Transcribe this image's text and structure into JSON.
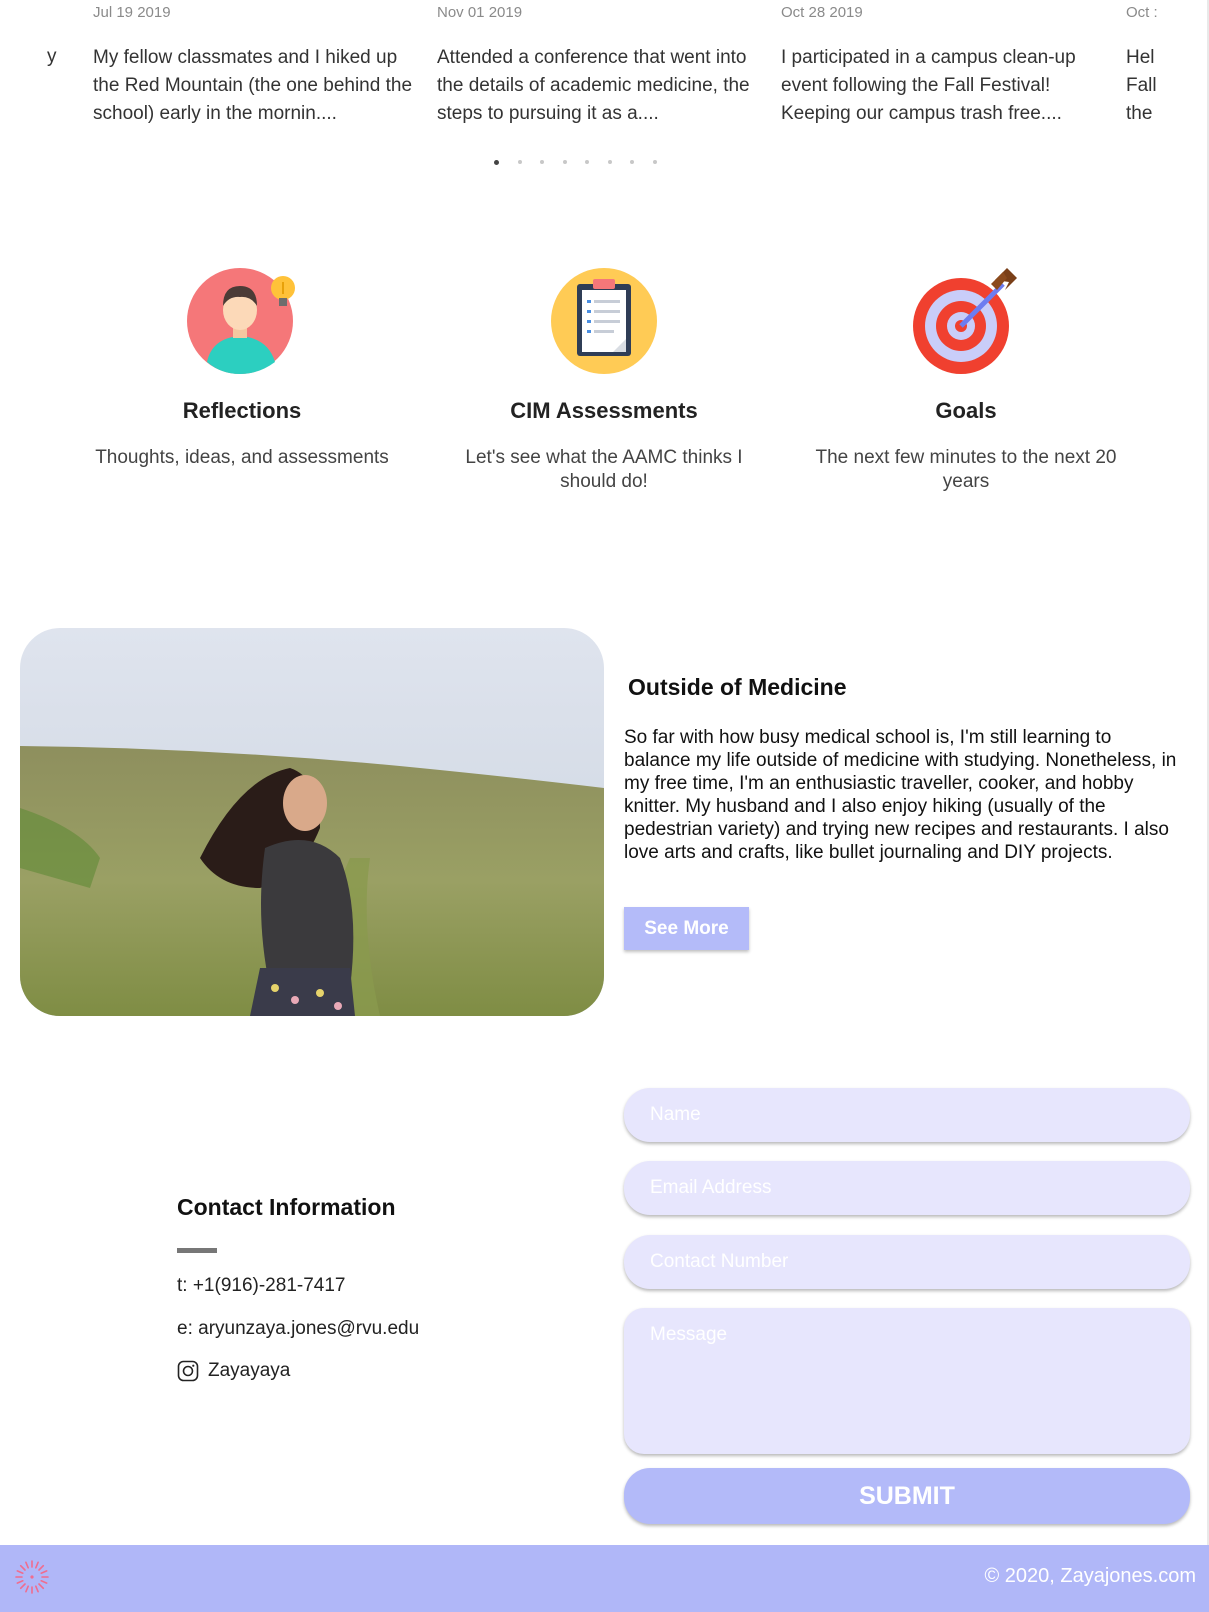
{
  "posts": [
    {
      "date": "Jul 19 2019",
      "excerpt": "My fellow classmates and I hiked up the Red Mountain (the one behind the school) early in the mornin...."
    },
    {
      "date": "Nov 01 2019",
      "excerpt": "Attended a conference that went into the details of academic medicine, the steps to pursuing it as a...."
    },
    {
      "date": "Oct 28 2019",
      "excerpt": "I participated in a campus clean-up event following the Fall Festival! Keeping our campus trash free...."
    },
    {
      "date": "Oct :",
      "excerpt": "Hel Fall the"
    }
  ],
  "prev_post_fragment": "y",
  "carousel": {
    "dot_count": 8,
    "active_index": 0
  },
  "features": [
    {
      "title": "Reflections",
      "description": "Thoughts, ideas, and assessments",
      "icon": "person-lightbulb-icon"
    },
    {
      "title": "CIM Assessments",
      "description": "Let's see what the AAMC thinks I should do!",
      "icon": "clipboard-icon"
    },
    {
      "title": "Goals",
      "description": "The next few minutes to the next 20 years",
      "icon": "target-arrow-icon"
    }
  ],
  "outside_medicine": {
    "title": "Outside of Medicine",
    "body": "So far with how busy medical school is, I'm still learning to balance my life outside of medicine with studying. Nonetheless, in my free time, I'm an enthusiastic traveller, cooker, and hobby knitter. My husband and I also enjoy hiking (usually of the pedestrian variety) and trying new recipes and restaurants. I also love arts and crafts, like bullet journaling and DIY projects.",
    "button_label": "See More"
  },
  "contact": {
    "title": "Contact Information",
    "phone": "t: +1(916)-281-7417",
    "email": "e: aryunzaya.jones@rvu.edu",
    "instagram": "Zayayaya"
  },
  "form": {
    "name_placeholder": "Name",
    "email_placeholder": "Email Address",
    "phone_placeholder": "Contact Number",
    "message_placeholder": "Message",
    "submit_label": "SUBMIT"
  },
  "footer": {
    "copyright": "© 2020, Zayajones.com"
  },
  "colors": {
    "accent": "#b0b7f8",
    "field_bg": "#e7e6fd",
    "button": "#b3baf9"
  }
}
